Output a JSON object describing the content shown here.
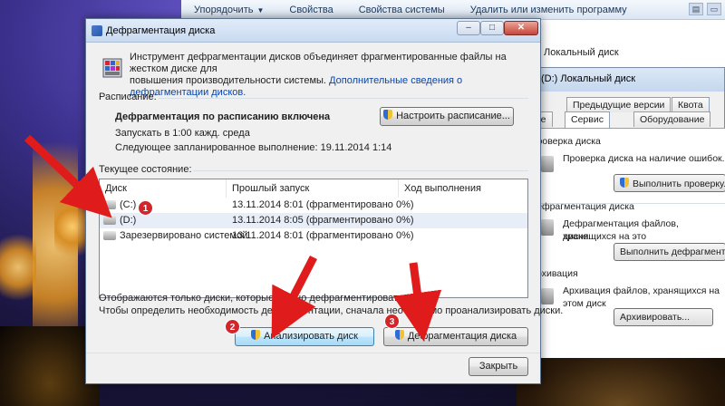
{
  "explorer": {
    "toolbar": [
      "Упорядочить",
      "Свойства",
      "Свойства системы",
      "Удалить или изменить программу"
    ],
    "local_disk": "Локальный диск"
  },
  "properties": {
    "title": "(D:) Локальный диск",
    "tabs_row1": [
      "Предыдущие версии",
      "Квота"
    ],
    "tabs_row2": [
      "Общие",
      "Сервис",
      "Оборудование"
    ],
    "active_tab": "Сервис",
    "check": {
      "title": "Проверка диска",
      "text": "Проверка диска на наличие ошибок.",
      "button": "Выполнить проверку..."
    },
    "defrag": {
      "title": "Дефрагментация диска",
      "text": "Дефрагментация файлов, хранящихся на это",
      "text2": "диске.",
      "button": "Выполнить дефрагментацию..."
    },
    "archive": {
      "title": "Архивация",
      "text": "Архивация файлов, хранящихся на этом диск",
      "button": "Архивировать..."
    }
  },
  "dialog": {
    "title": "Дефрагментация диска",
    "intro_line1": "Инструмент дефрагментации дисков объединяет фрагментированные файлы на жестком диске для",
    "intro_line2": "повышения производительности системы.",
    "intro_link": "Дополнительные сведения о дефрагментации дисков.",
    "schedule_label": "Расписание:",
    "schedule_status": "Дефрагментация по расписанию включена",
    "schedule_when": "Запускать в 1:00 кажд. среда",
    "next_run": "Следующее запланированное выполнение: 19.11.2014 1:14",
    "configure_button": "Настроить расписание...",
    "current_state_label": "Текущее состояние:",
    "columns": [
      "Диск",
      "Прошлый запуск",
      "Ход выполнения"
    ],
    "disks": [
      {
        "name": "(C:)",
        "last_run": "13.11.2014 8:01 (фрагментировано 0%)",
        "progress": ""
      },
      {
        "name": "(D:)",
        "last_run": "13.11.2014 8:05 (фрагментировано 0%)",
        "progress": ""
      },
      {
        "name": "Зарезервировано системой",
        "last_run": "13.11.2014 8:01 (фрагментировано 0%)",
        "progress": ""
      }
    ],
    "note1": "Отображаются только диски, которые можно дефрагментировать.",
    "note2": "Чтобы определить необходимость дефрагментации, сначала необходимо проанализировать диски.",
    "analyze_button": "Анализировать диск",
    "defrag_button": "Дефрагментация диска",
    "close_button": "Закрыть"
  },
  "annotations": [
    "1",
    "2",
    "3"
  ],
  "colors": {
    "arrow": "#e01b1b",
    "badge": "#d4252a",
    "link": "#0645ad"
  }
}
